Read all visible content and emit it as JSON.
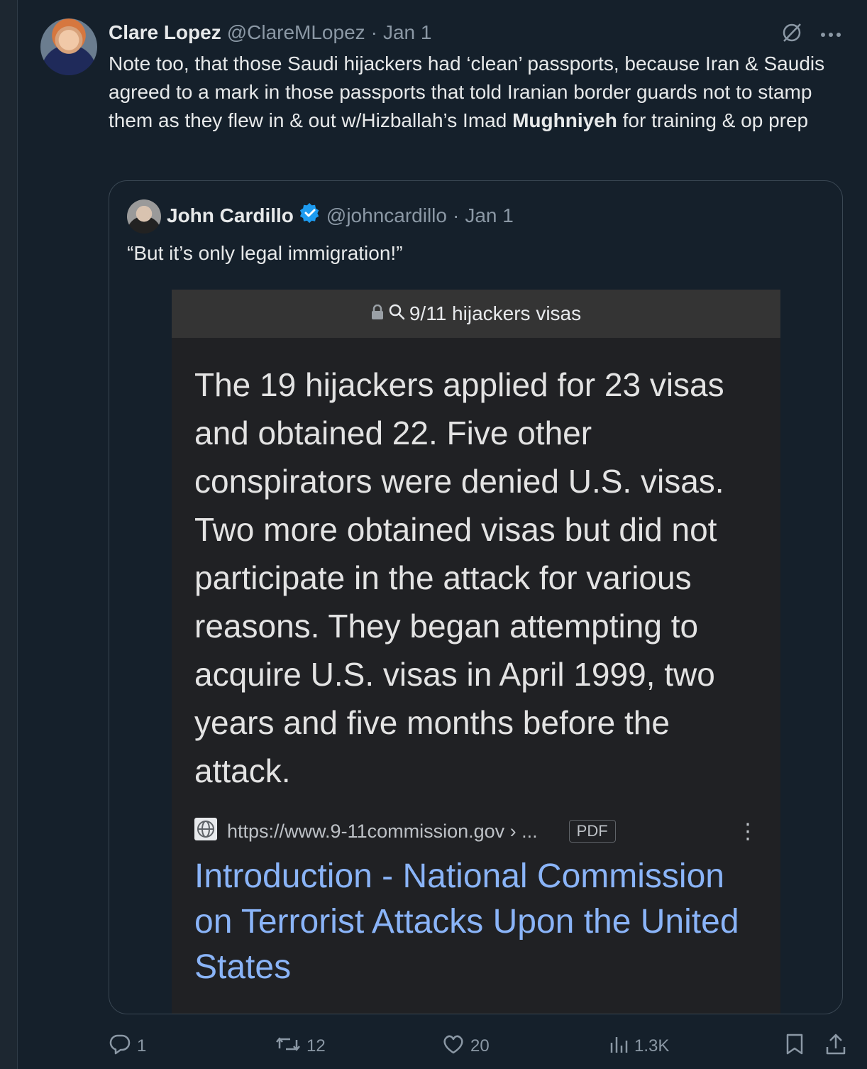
{
  "post": {
    "author_name": "Clare Lopez",
    "author_handle": "@ClareMLopez",
    "separator": "·",
    "timestamp": "Jan 1",
    "text_before_bold": "Note too, that those Saudi hijackers had ‘clean’ passports, because Iran & Saudis agreed to a mark in those passports that told Iranian border guards not to stamp them as they flew in & out w/Hizballah’s Imad ",
    "text_bold": "Mughniyeh",
    "text_after_bold": " for training & op prep",
    "more_icon": "ellipsis-icon",
    "grok_icon": "grok-icon"
  },
  "quote": {
    "author_name": "John Cardillo",
    "author_handle": "@johncardillo",
    "separator": "·",
    "timestamp": "Jan 1",
    "verified": true,
    "text": "“But it’s only legal immigration!”"
  },
  "screenshot": {
    "search_query": "9/11 hijackers visas",
    "body": "The 19 hijackers applied for 23 visas and obtained 22. Five other conspirators were denied U.S. visas. Two more obtained visas but did not participate in the attack for various reasons. They began attempting to acquire U.S. visas in April 1999, two years and five months before the attack.",
    "source_url": "https://www.9-11commission.gov › ...",
    "source_tag": "PDF",
    "result_title": "Introduction - National Commission on Terrorist Attacks Upon the United States"
  },
  "actions": {
    "replies": "1",
    "reposts": "12",
    "likes": "20",
    "views": "1.3K"
  },
  "colors": {
    "background": "#15202b",
    "secondary_text": "#8b98a5",
    "verified_blue": "#1d9bf0",
    "link_blue": "#8ab4f8"
  }
}
